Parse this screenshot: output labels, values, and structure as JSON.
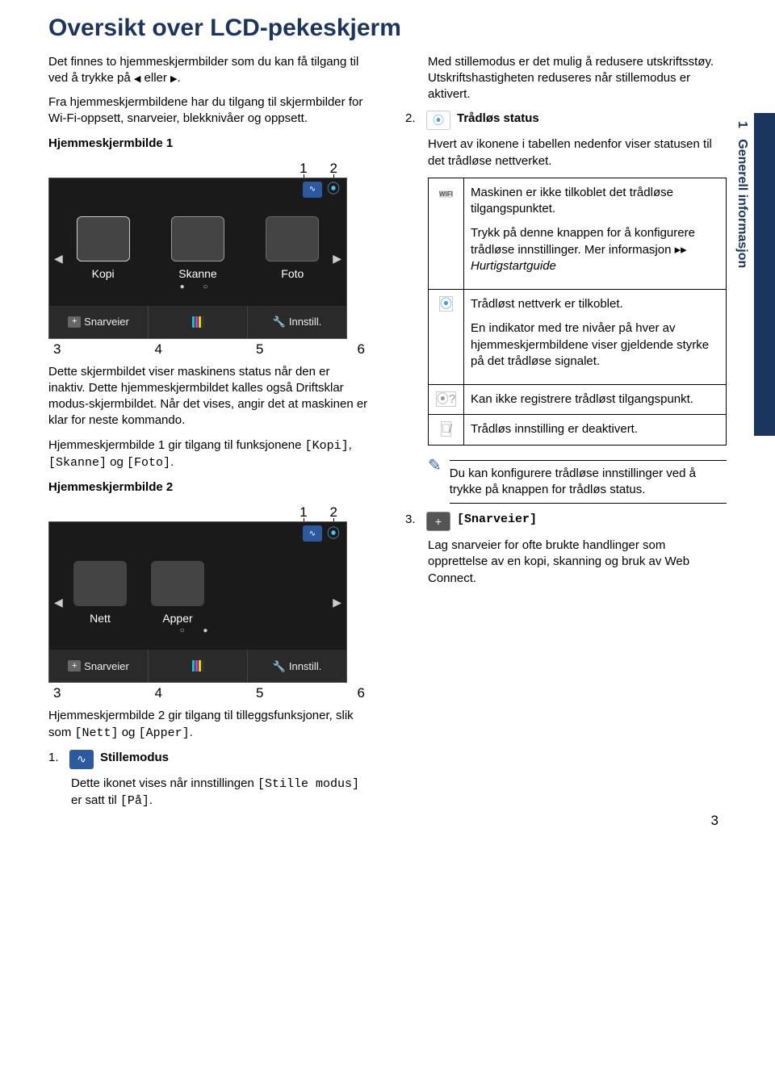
{
  "title": "Oversikt over LCD-pekeskjerm",
  "sideTab": "Generell informasjon",
  "sideTabNum": "1",
  "pageNumber": "3",
  "left": {
    "intro1_a": "Det finnes to hjemmeskjermbilder som du kan få tilgang til ved å trykke på ",
    "intro1_b": " eller ",
    "intro1_c": ".",
    "intro2": "Fra hjemmeskjermbildene har du tilgang til skjermbilder for Wi-Fi-oppsett, snarveier, blekknivåer og oppsett.",
    "home1Title": "Hjemmeskjermbilde 1",
    "calloutTop1": "1",
    "calloutTop2": "2",
    "calloutBot3": "3",
    "calloutBot4": "4",
    "calloutBot5": "5",
    "calloutBot6": "6",
    "screen1": {
      "kopi": "Kopi",
      "skanne": "Skanne",
      "foto": "Foto",
      "snarveier": "Snarveier",
      "innstill": "Innstill."
    },
    "afterFig1": "Dette skjermbildet viser maskinens status når den er inaktiv. Dette hjemmeskjermbildet kalles også Driftsklar modus-skjermbildet. Når det vises, angir det at maskinen er klar for neste kommando.",
    "afterFig1b_a": "Hjemmeskjermbilde 1 gir tilgang til funksjonene ",
    "afterFig1b_kopi": "[Kopi]",
    "afterFig1b_sep1": ", ",
    "afterFig1b_skanne": "[Skanne]",
    "afterFig1b_sep2": " og ",
    "afterFig1b_foto": "[Foto]",
    "afterFig1b_end": ".",
    "home2Title": "Hjemmeskjermbilde 2",
    "screen2": {
      "nett": "Nett",
      "apper": "Apper",
      "snarveier": "Snarveier",
      "innstill": "Innstill."
    },
    "afterFig2_a": "Hjemmeskjermbilde 2 gir tilgang til tilleggsfunksjoner, slik som ",
    "afterFig2_nett": "[Nett]",
    "afterFig2_sep": " og ",
    "afterFig2_apper": "[Apper]",
    "afterFig2_end": ".",
    "item1_n": "1.",
    "item1_label": "Stillemodus",
    "item1_text_a": "Dette ikonet vises når innstillingen ",
    "item1_text_mono": "[Stille modus]",
    "item1_text_b": " er satt til ",
    "item1_text_mono2": "[På]",
    "item1_text_c": "."
  },
  "right": {
    "topPara": "Med stillemodus er det mulig å redusere utskriftsstøy. Utskriftshastigheten reduseres når stillemodus er aktivert.",
    "item2_n": "2.",
    "item2_label": "Trådløs status",
    "item2_text": "Hvert av ikonene i tabellen nedenfor viser statusen til det trådløse nettverket.",
    "row1a": "Maskinen er ikke tilkoblet det trådløse tilgangspunktet.",
    "row1b_a": "Trykk på denne knappen for å konfigurere trådløse innstillinger. Mer informasjon ",
    "row1b_arrows": "▸▸",
    "row1b_b": " Hurtigstartguide",
    "row1_badge": "WIFI",
    "row2a": "Trådløst nettverk er tilkoblet.",
    "row2b": "En indikator med tre nivåer på hver av hjemmeskjermbildene viser gjeldende styrke på det trådløse signalet.",
    "row3": "Kan ikke registrere trådløst tilgangspunkt.",
    "row4": "Trådløs innstilling er deaktivert.",
    "noteText": "Du kan konfigurere trådløse innstillinger ved å trykke på knappen for trådløs status.",
    "item3_n": "3.",
    "item3_label": "[Snarveier]",
    "item3_text": "Lag snarveier for ofte brukte handlinger som opprettelse av en kopi, skanning og bruk av Web Connect."
  }
}
